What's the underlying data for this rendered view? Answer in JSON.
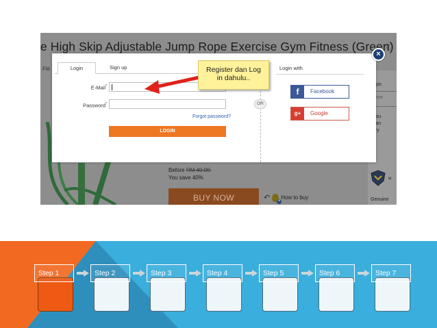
{
  "screenshot": {
    "product_title": "re High Skip Adjustable Jump Rope Exercise Gym Fitness (Green)",
    "side_label": "Fle",
    "right_panel_lines": [
      "ter po",
      "ter me",
      "d you",
      "u can",
      "ivery"
    ],
    "price_before_label": "Before",
    "price_before_value": "RM 40.00.",
    "you_save": "You save 40%",
    "buy_now_label": "BUY NOW",
    "how_to_buy": "How to buy",
    "genuine_label": "Genuine",
    "badge_label": "w"
  },
  "modal": {
    "tabs": [
      {
        "label": "Login"
      },
      {
        "label": "Sign up"
      }
    ],
    "email_label": "E-Mail",
    "password_label": "Password",
    "required_mark": "*",
    "forgot_password": "Forgot password?",
    "login_button": "LOGIN",
    "or_label": "OR",
    "login_with": "Login with",
    "facebook_label": "Facebook",
    "facebook_icon": "f",
    "google_label": "Google",
    "google_icon": "g+",
    "close_icon": "×"
  },
  "callout": {
    "line1": "Register dan Log",
    "line2": "in dahulu.."
  },
  "steps": [
    {
      "label": "Step 1",
      "active": true
    },
    {
      "label": "Step 2",
      "active": false
    },
    {
      "label": "Step 3",
      "active": false
    },
    {
      "label": "Step 4",
      "active": false
    },
    {
      "label": "Step 5",
      "active": false
    },
    {
      "label": "Step 6",
      "active": false
    },
    {
      "label": "Step 7",
      "active": false
    }
  ],
  "colors": {
    "band_blue": "#3aaedc",
    "band_orange": "#f26a22",
    "active_step": "#ee5a14",
    "login_button": "#ee7722",
    "facebook": "#3b5998",
    "google": "#d73d32",
    "callout": "#fff29a",
    "arrow_red": "#e0211a"
  }
}
